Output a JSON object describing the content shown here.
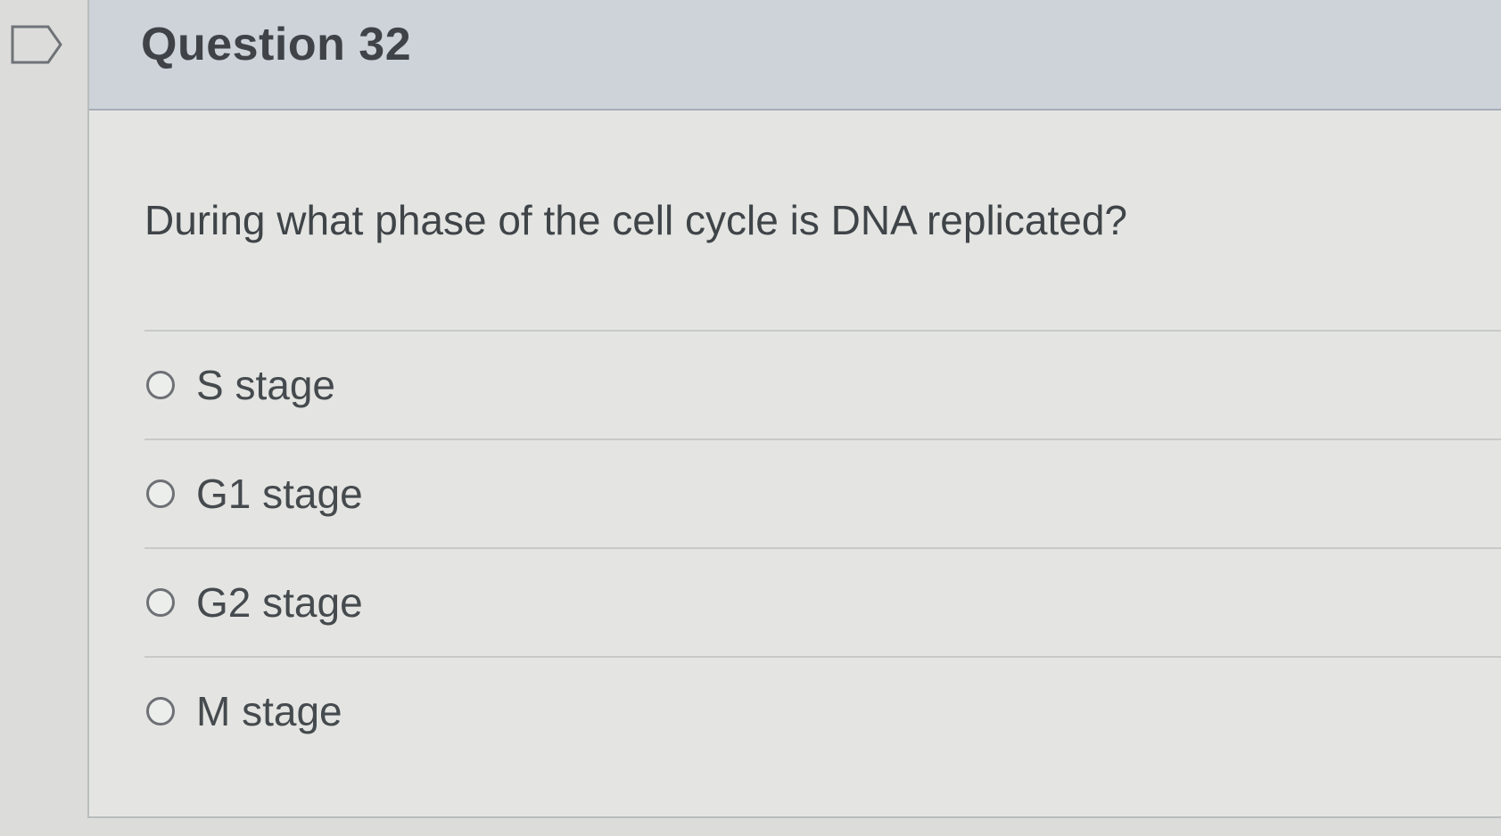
{
  "question": {
    "title": "Question 32",
    "text": "During what phase of the cell cycle is DNA replicated?"
  },
  "answers": [
    {
      "label": "S stage"
    },
    {
      "label": "G1 stage"
    },
    {
      "label": "G2 stage"
    },
    {
      "label": "M stage"
    }
  ],
  "icons": {
    "flag": "flag-outline-icon",
    "radio": "radio-button-icon"
  },
  "colors": {
    "header_bg": "#cdd3d9",
    "card_bg": "#e4e5e2",
    "text": "#3f4448"
  }
}
